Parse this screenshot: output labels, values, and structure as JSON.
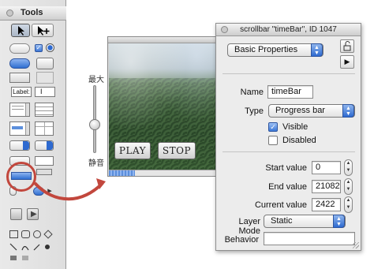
{
  "tools_palette": {
    "title": "Tools",
    "label_tool_text": "Label:"
  },
  "stage": {
    "play_label": "PLAY",
    "stop_label": "STOP",
    "slider_top_label": "最大",
    "slider_bottom_label": "静音",
    "timebar_progress_fraction": 0.24
  },
  "inspector": {
    "title": "scrollbar \"timeBar\", ID 1047",
    "section_popup": "Basic Properties",
    "name_label": "Name",
    "name_value": "timeBar",
    "type_label": "Type",
    "type_value": "Progress bar",
    "visible_label": "Visible",
    "visible_checked": true,
    "disabled_label": "Disabled",
    "disabled_checked": false,
    "start_label": "Start value",
    "start_value": "0",
    "end_label": "End value",
    "end_value": "21082",
    "current_label": "Current value",
    "current_value": "2422",
    "layer_mode_label": "Layer Mode",
    "layer_mode_value": "Static",
    "behavior_label": "Behavior",
    "behavior_value": ""
  },
  "colors": {
    "accent_blue": "#2e6ad0",
    "highlight_red": "#c2473d"
  },
  "icons": {
    "lock": "lock-icon",
    "play": "play-icon",
    "checkmark": "check-icon"
  }
}
